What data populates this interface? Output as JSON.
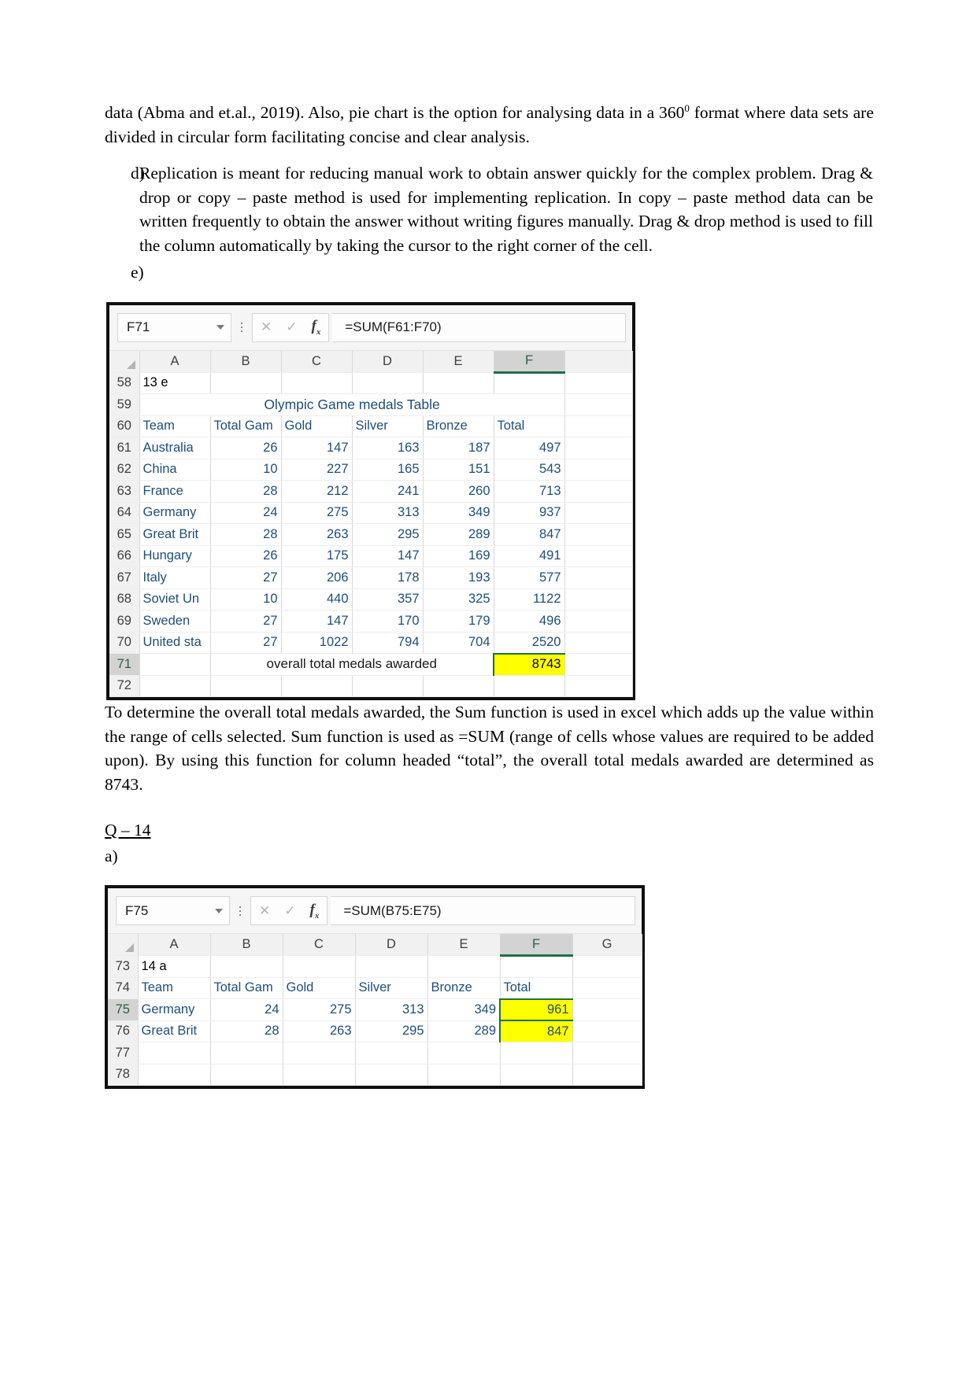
{
  "document": {
    "intro_paragraph": "data (Abma and et.al., 2019). Also, pie chart is the option for analysing data in a 360⁰ format where data sets are divided in circular form facilitating concise and clear analysis.",
    "intro_line1": "data (Abma and et.al., 2019). Also, pie chart is the option for analysing data in a 360",
    "intro_sup": "0",
    "intro_line1b": " format",
    "intro_line2": "where data sets are divided in circular form facilitating concise and clear analysis.",
    "item_d_marker": "d)",
    "item_d_text": "Replication is meant for reducing manual work to obtain answer quickly for the complex problem. Drag & drop or copy – paste method is used for implementing replication. In copy – paste method data can be written frequently to obtain the answer without writing figures manually. Drag & drop method is used to fill the column automatically by taking the cursor to the right corner of the cell.",
    "item_e_marker": "e)",
    "explanation_paragraph": "To determine the overall total medals awarded, the Sum function is used in excel which adds up the value within the range of cells selected. Sum function is used as =SUM (range of cells whose values are required to be added upon). By using this function for column headed “total”, the overall total medals awarded are determined as 8743.",
    "question_heading": "Q – 14",
    "item_a_marker": "a)"
  },
  "spreadsheet1": {
    "name_box": "F71",
    "formula": "=SUM(F61:F70)",
    "cancel_icon": "cancel-icon",
    "confirm_icon": "confirm-icon",
    "fx_icon": "fx-icon",
    "column_headers": [
      "A",
      "B",
      "C",
      "D",
      "E",
      "F",
      ""
    ],
    "selected_column": "F",
    "row_numbers": [
      "58",
      "59",
      "60",
      "61",
      "62",
      "63",
      "64",
      "65",
      "66",
      "67",
      "68",
      "69",
      "70",
      "71",
      "72"
    ],
    "active_row": "71",
    "cell_a58": "13 e",
    "table_title": "Olympic Game medals Table",
    "table_headers": [
      "Team",
      "Total Gam",
      "Gold",
      "Silver",
      "Bronze",
      "Total"
    ],
    "rows": [
      {
        "row": "61",
        "team": "Australia",
        "games": "26",
        "gold": "147",
        "silver": "163",
        "bronze": "187",
        "total": "497"
      },
      {
        "row": "62",
        "team": "China",
        "games": "10",
        "gold": "227",
        "silver": "165",
        "bronze": "151",
        "total": "543"
      },
      {
        "row": "63",
        "team": "France",
        "games": "28",
        "gold": "212",
        "silver": "241",
        "bronze": "260",
        "total": "713"
      },
      {
        "row": "64",
        "team": "Germany",
        "games": "24",
        "gold": "275",
        "silver": "313",
        "bronze": "349",
        "total": "937"
      },
      {
        "row": "65",
        "team": "Great Brit",
        "games": "28",
        "gold": "263",
        "silver": "295",
        "bronze": "289",
        "total": "847"
      },
      {
        "row": "66",
        "team": "Hungary",
        "games": "26",
        "gold": "175",
        "silver": "147",
        "bronze": "169",
        "total": "491"
      },
      {
        "row": "67",
        "team": "Italy",
        "games": "27",
        "gold": "206",
        "silver": "178",
        "bronze": "193",
        "total": "577"
      },
      {
        "row": "68",
        "team": "Soviet Un",
        "games": "10",
        "gold": "440",
        "silver": "357",
        "bronze": "325",
        "total": "1122"
      },
      {
        "row": "69",
        "team": "Sweden",
        "games": "27",
        "gold": "147",
        "silver": "170",
        "bronze": "179",
        "total": "496"
      },
      {
        "row": "70",
        "team": "United sta",
        "games": "27",
        "gold": "1022",
        "silver": "794",
        "bronze": "704",
        "total": "2520"
      }
    ],
    "summary_label": "overall total medals awarded",
    "summary_value": "8743",
    "summary_highlight_color": "#ffff00"
  },
  "spreadsheet2": {
    "name_box": "F75",
    "formula": "=SUM(B75:E75)",
    "cancel_icon": "cancel-icon",
    "confirm_icon": "confirm-icon",
    "fx_icon": "fx-icon",
    "column_headers": [
      "A",
      "B",
      "C",
      "D",
      "E",
      "F",
      "G"
    ],
    "selected_column": "F",
    "row_numbers": [
      "73",
      "74",
      "75",
      "76",
      "77",
      "78"
    ],
    "cell_a73": "14 a",
    "table_headers": [
      "Team",
      "Total Gam",
      "Gold",
      "Silver",
      "Bronze",
      "Total"
    ],
    "rows": [
      {
        "row": "75",
        "team": "Germany",
        "games": "24",
        "gold": "275",
        "silver": "313",
        "bronze": "349",
        "total": "961"
      },
      {
        "row": "76",
        "team": "Great Brit",
        "games": "28",
        "gold": "263",
        "silver": "295",
        "bronze": "289",
        "total": "847"
      }
    ],
    "highlight_color": "#ffff00"
  }
}
